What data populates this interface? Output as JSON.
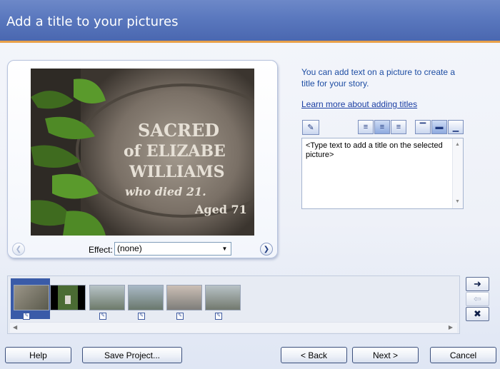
{
  "header": {
    "title": "Add a title to your pictures"
  },
  "preview": {
    "effect_label": "Effect:",
    "effect_value": "(none)",
    "photo_text": [
      "SACRED",
      "of ELIZABE",
      "WILLIAMS",
      "who died 21.",
      "Aged 71"
    ]
  },
  "info": {
    "description": "You can add text on a picture to create a title for your story.",
    "learn_link": "Learn more about adding titles"
  },
  "title_text": {
    "placeholder": "<Type text to add a title on the selected picture>"
  },
  "toolbar": {
    "icons": [
      "font-icon",
      "align-left-icon",
      "align-center-icon",
      "align-right-icon",
      "position-top-icon",
      "position-middle-icon",
      "position-bottom-icon"
    ]
  },
  "buttons": {
    "help": "Help",
    "save_project": "Save Project...",
    "back": "< Back",
    "next": "Next >",
    "cancel": "Cancel"
  }
}
